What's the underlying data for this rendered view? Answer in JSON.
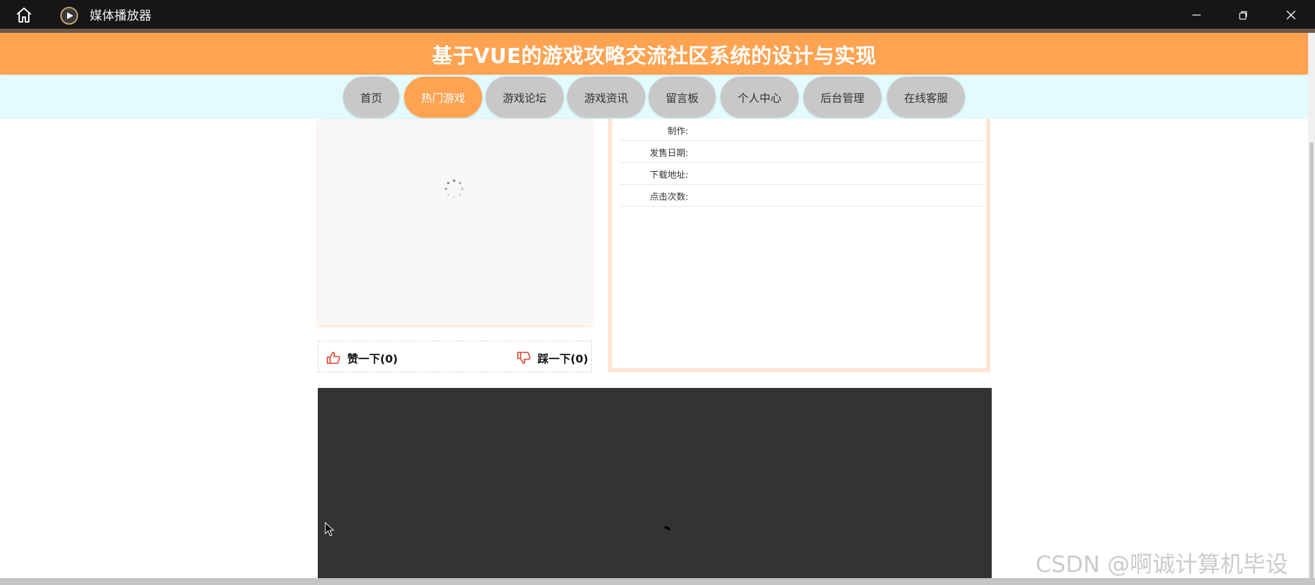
{
  "window": {
    "title": "媒体播放器",
    "controls": {
      "minimize": "minimize-icon",
      "maximize": "restore-icon",
      "close": "close-icon"
    }
  },
  "header": {
    "title": "基于VUE的游戏攻略交流社区系统的设计与实现"
  },
  "nav": {
    "items": [
      {
        "label": "首页",
        "active": false
      },
      {
        "label": "热门游戏",
        "active": true
      },
      {
        "label": "游戏论坛",
        "active": false
      },
      {
        "label": "游戏资讯",
        "active": false
      },
      {
        "label": "留言板",
        "active": false
      },
      {
        "label": "个人中心",
        "active": false
      },
      {
        "label": "后台管理",
        "active": false
      },
      {
        "label": "在线客服",
        "active": false
      }
    ]
  },
  "detail": {
    "fields": [
      {
        "label": "制作:",
        "value": ""
      },
      {
        "label": "发售日期:",
        "value": ""
      },
      {
        "label": "下载地址:",
        "value": ""
      },
      {
        "label": "点击次数:",
        "value": ""
      }
    ]
  },
  "votes": {
    "like": "赞一下(0)",
    "dislike": "踩一下(0)"
  },
  "watermark": "CSDN @啊诚计算机毕设",
  "colors": {
    "accent": "#ffa352",
    "nav_bg": "#e3fbff",
    "nav_item": "#c8c8c8",
    "video_bg": "#333333",
    "panel_border": "#ffe3d3"
  }
}
